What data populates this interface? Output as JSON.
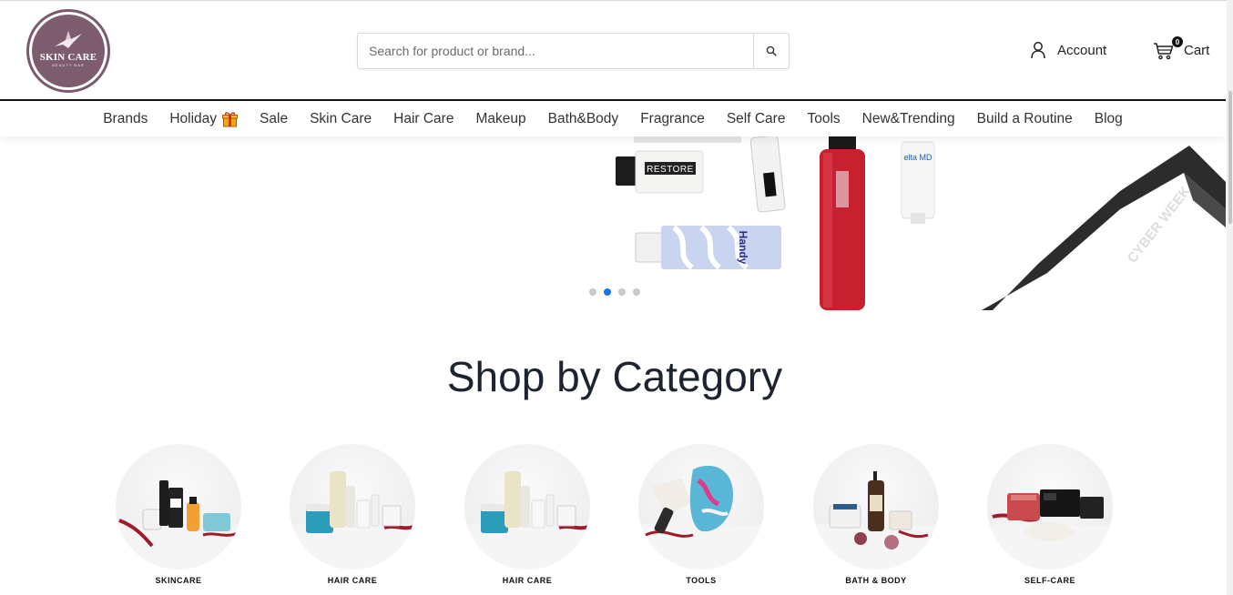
{
  "header": {
    "logo": {
      "title": "SKIN CARE",
      "subtitle": "BEAUTY BAR",
      "color": "#7d5c6f"
    },
    "search": {
      "placeholder": "Search for product or brand...",
      "value": "",
      "icon": "search-icon"
    },
    "account": {
      "label": "Account",
      "icon": "user-icon"
    },
    "cart": {
      "label": "Cart",
      "count": "0",
      "icon": "cart-icon"
    }
  },
  "nav": {
    "items": [
      {
        "label": "Brands"
      },
      {
        "label": "Holiday",
        "icon": "gift-icon"
      },
      {
        "label": "Sale"
      },
      {
        "label": "Skin Care"
      },
      {
        "label": "Hair Care"
      },
      {
        "label": "Makeup"
      },
      {
        "label": "Bath&Body"
      },
      {
        "label": "Fragrance"
      },
      {
        "label": "Self Care"
      },
      {
        "label": "Tools"
      },
      {
        "label": "New&Trending"
      },
      {
        "label": "Build a Routine"
      },
      {
        "label": "Blog"
      }
    ]
  },
  "hero": {
    "product_texts": {
      "restore": "RESTORE",
      "ribbon": "CYBER WEEK",
      "tube_brand": "Handy",
      "cream_brand": "elta MD"
    },
    "slides_total": 4,
    "active_slide": 2
  },
  "categories_section": {
    "title": "Shop by Category",
    "items": [
      {
        "label": "SKINCARE"
      },
      {
        "label": "HAIR CARE"
      },
      {
        "label": "HAIR CARE"
      },
      {
        "label": "TOOLS"
      },
      {
        "label": "BATH & BODY"
      },
      {
        "label": "SELF-CARE"
      }
    ]
  },
  "colors": {
    "accent": "#1a73e8",
    "text": "#1d2430",
    "brand": "#7d5c6f"
  }
}
